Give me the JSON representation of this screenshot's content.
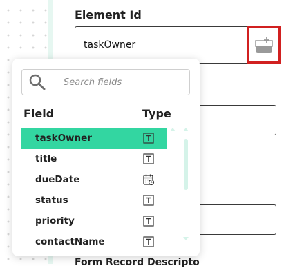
{
  "form": {
    "element_id_label": "Element Id",
    "element_id_value": "taskOwner",
    "next_label_partial": "Form Record Descripto"
  },
  "picker": {
    "search_placeholder": "Search fields",
    "field_header": "Field",
    "type_header": "Type",
    "fields": [
      {
        "name": "taskOwner",
        "type": "text-icon",
        "selected": true
      },
      {
        "name": "title",
        "type": "text-icon",
        "selected": false
      },
      {
        "name": "dueDate",
        "type": "calendar-icon",
        "selected": false
      },
      {
        "name": "status",
        "type": "text-icon",
        "selected": false
      },
      {
        "name": "priority",
        "type": "text-icon",
        "selected": false
      },
      {
        "name": "contactName",
        "type": "text-icon",
        "selected": false
      }
    ]
  },
  "colors": {
    "selected_row": "#33d6a1",
    "highlight_border": "#d12020",
    "scroll_accent": "#d5f3e9"
  }
}
